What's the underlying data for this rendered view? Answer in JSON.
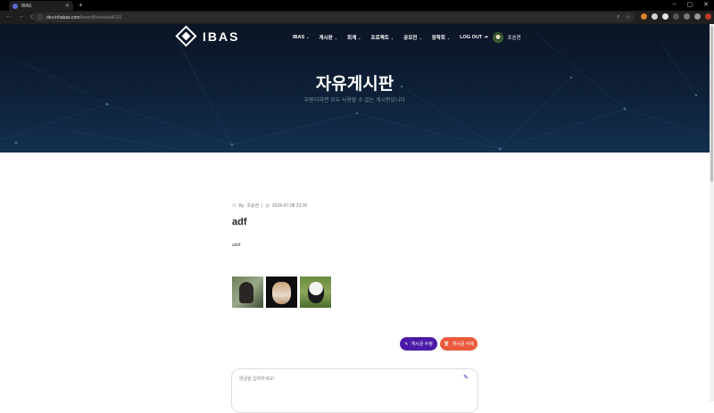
{
  "browser": {
    "tab_title": "IBAS",
    "new_tab": "+",
    "url_domain": "dev.inhabas.com",
    "url_path": "/board/free/detail/221",
    "window_controls": [
      "–",
      "▢",
      "✕"
    ],
    "nav_icons": [
      "←",
      "→",
      "⟳"
    ]
  },
  "header": {
    "logo_text": "IBAS",
    "nav": [
      {
        "label": "IBAS",
        "caret": "⌄"
      },
      {
        "label": "게시판",
        "caret": "⌄"
      },
      {
        "label": "회계",
        "caret": "⌄"
      },
      {
        "label": "프로젝트",
        "caret": "⌄"
      },
      {
        "label": "공모전",
        "caret": "⌄"
      },
      {
        "label": "장학회",
        "caret": "⌄"
      }
    ],
    "logout_label": "LOG OUT",
    "logout_icon": "⇥",
    "user_name": "조승현"
  },
  "hero": {
    "title": "자유게시판",
    "subtitle": "부원이라면 모두 사용할 수 있는 게시판입니다"
  },
  "post": {
    "author_prefix": "By",
    "author": "조승현",
    "separator": "|",
    "date": "2024-07-08 23:30",
    "title": "adf",
    "body": "adsf",
    "images": [
      "bear-photo",
      "cat-photo",
      "panda-photo"
    ]
  },
  "actions": {
    "edit_label": "게시글 수정",
    "delete_label": "게시글 삭제"
  },
  "comment": {
    "placeholder": "댓글을 입력하세요!"
  },
  "colors": {
    "accent_purple": "#4b1aa8",
    "delete_orange": "#ea5a3c",
    "hero_dark": "#0b1424"
  }
}
